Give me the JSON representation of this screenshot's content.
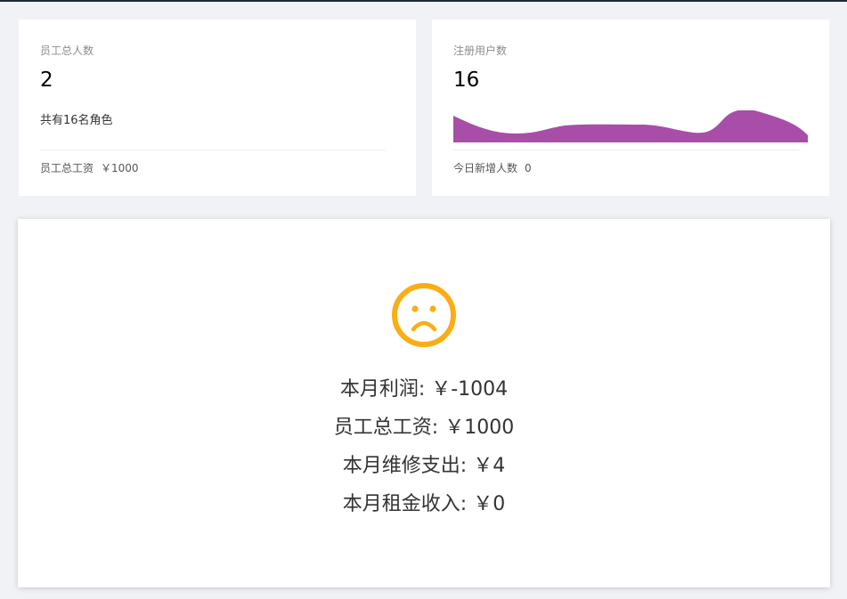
{
  "employee_card": {
    "label": "员工总人数",
    "value": "2",
    "sub": "共有16名角色",
    "footer_label": "员工总工资",
    "footer_value": "￥1000"
  },
  "user_card": {
    "label": "注册用户数",
    "value": "16",
    "footer_label": "今日新增人数",
    "footer_value": "0",
    "wave_color": "#a84ea8"
  },
  "summary": {
    "icon": "sad-face-icon",
    "icon_color": "#faad14",
    "profit": "本月利润: ￥-1004",
    "salary": "员工总工资: ￥1000",
    "repair": "本月维修支出: ￥4",
    "rent": "本月租金收入: ￥0"
  }
}
